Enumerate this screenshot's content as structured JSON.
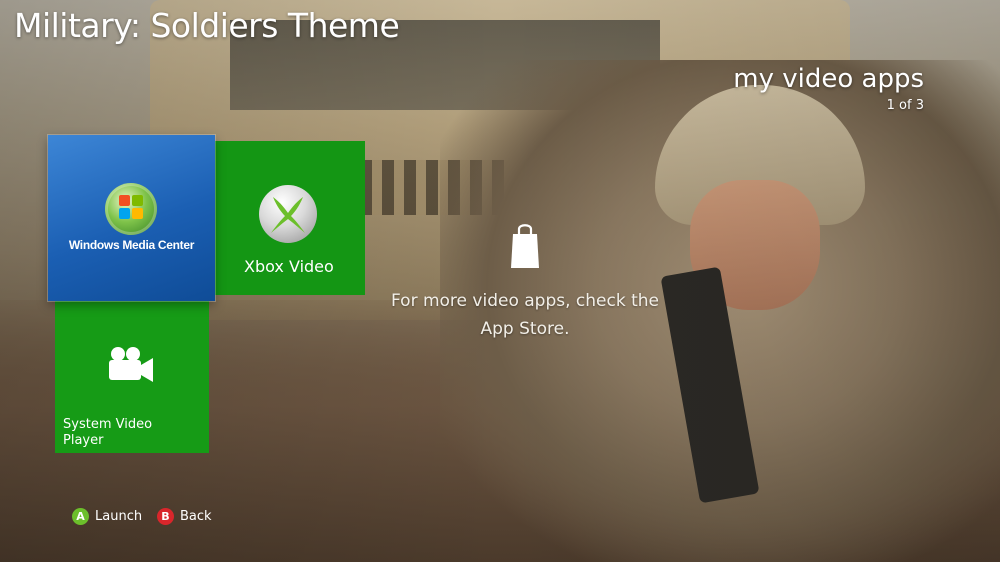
{
  "header": {
    "theme_title": "Military: Soldiers Theme",
    "section_title": "my video apps",
    "section_page": "1 of 3"
  },
  "tiles": [
    {
      "id": "windows-media-center",
      "label": "Windows Media Center",
      "color": "#1b5fb3",
      "icon": "windows-orb-icon",
      "selected": true
    },
    {
      "id": "xbox-video",
      "label": "Xbox Video",
      "color": "#149614",
      "icon": "xbox-sphere-icon"
    },
    {
      "id": "system-video-player",
      "label": "System Video Player",
      "color": "#169b16",
      "icon": "video-camera-icon"
    }
  ],
  "store_hint": {
    "icon": "shopping-bag-icon",
    "text": "For more video apps, check the App Store."
  },
  "footer": {
    "buttons": [
      {
        "key": "A",
        "label": "Launch",
        "color": "#6cbf2b"
      },
      {
        "key": "B",
        "label": "Back",
        "color": "#d9262b"
      }
    ]
  },
  "colors": {
    "tile_green": "#149614",
    "tile_blue": "#1b5fb3",
    "text": "#ffffff"
  }
}
